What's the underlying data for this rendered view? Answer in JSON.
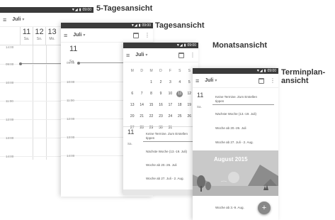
{
  "captions": {
    "five_day": "5-Tagesansicht",
    "day": "Tagesansicht",
    "month": "Monatsansicht",
    "agenda_line1": "Terminplan-",
    "agenda_line2": "ansicht"
  },
  "status": {
    "time": "09:00"
  },
  "toolbar": {
    "month_label": "Juli"
  },
  "five_day": {
    "days": [
      {
        "num": "11",
        "wd": "Sa."
      },
      {
        "num": "12",
        "wd": "So."
      },
      {
        "num": "13",
        "wd": "Mo."
      }
    ],
    "times": [
      "14:00",
      "09:00",
      "10:00",
      "11:00",
      "12:00",
      "13:00",
      "14:00"
    ]
  },
  "day_view": {
    "num": "11",
    "wd": "Sa.",
    "times": [
      "09:00",
      "10:00",
      "11:00",
      "12:00",
      "13:00",
      "14:00"
    ]
  },
  "month_view": {
    "weekdays": [
      "M",
      "D",
      "M",
      "D",
      "F",
      "S",
      "S"
    ],
    "weeks": [
      [
        "",
        "",
        "1",
        "2",
        "3",
        "4",
        "5"
      ],
      [
        "6",
        "7",
        "8",
        "9",
        "10",
        "11",
        "12"
      ],
      [
        "13",
        "14",
        "15",
        "16",
        "17",
        "18",
        "19"
      ],
      [
        "20",
        "21",
        "22",
        "23",
        "24",
        "25",
        "26"
      ],
      [
        "27",
        "28",
        "29",
        "30",
        "31",
        "",
        ""
      ]
    ],
    "selected": "11",
    "agenda_day_num": "11",
    "agenda_day_wd": "Sa.",
    "agenda_items": [
      "Keine Termine. Zum Erstellen tippen",
      "Nächste Woche (13.-19. Juli)",
      "Woche ab 20.-26. Juli",
      "Woche ab 27. Juli - 2. Aug."
    ]
  },
  "agenda_view": {
    "day_num": "11",
    "day_wd": "Sa.",
    "items": [
      "Keine Termine. Zum Erstellen tippen",
      "Nächste Woche (13.-19. Juli)",
      "Woche ab 20.-26. Juli",
      "Woche ab 27. Juli - 2. Aug."
    ],
    "month_banner": "August 2015",
    "after_banner": "Woche ab 3.-9. Aug.",
    "fab": "+"
  },
  "colors": {
    "status_bar": "#3a3a3a",
    "illustration": "#c7c7c7",
    "fab": "#888888"
  }
}
